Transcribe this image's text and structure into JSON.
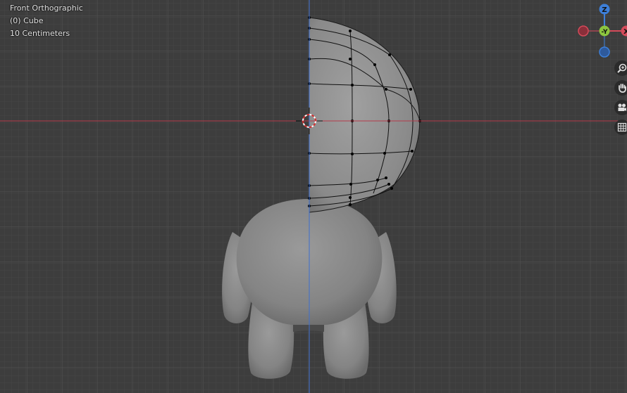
{
  "viewport": {
    "view_name": "Front Orthographic",
    "object_info": "(0) Cube",
    "grid_scale": "10 Centimeters"
  },
  "gizmo": {
    "z_label": "Z",
    "y_label": "-Y",
    "x_label": "X",
    "colors": {
      "x": "#d44a5a",
      "y": "#8cc63f",
      "z": "#3d7fd9"
    }
  },
  "nav_buttons": [
    {
      "name": "zoom-icon"
    },
    {
      "name": "hand-pan-icon"
    },
    {
      "name": "camera-icon"
    },
    {
      "name": "grid-ortho-icon"
    }
  ],
  "colors": {
    "background": "#3d3d3d",
    "x_axis": "#b53a4a",
    "z_axis": "#3d6fcf",
    "mesh": "#878787"
  }
}
